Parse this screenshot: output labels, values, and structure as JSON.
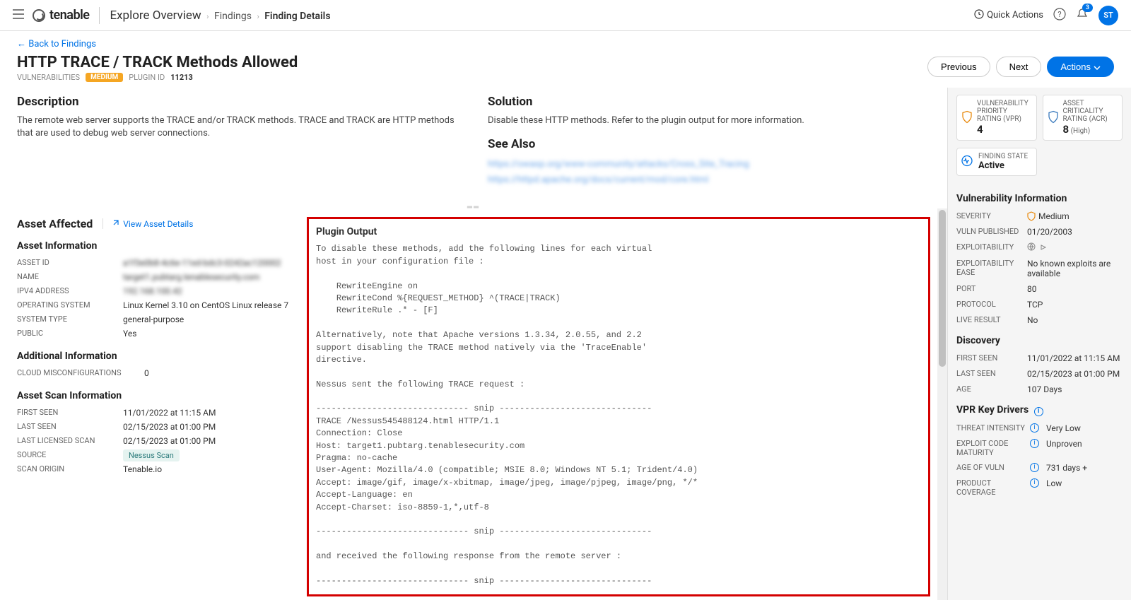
{
  "header": {
    "logo": "tenable",
    "breadcrumb_main": "Explore Overview",
    "breadcrumb_1": "Findings",
    "breadcrumb_2": "Finding Details",
    "quick_actions": "Quick Actions",
    "notif_count": "3",
    "avatar": "ST"
  },
  "page": {
    "back_link": "← Back to Findings",
    "title": "HTTP TRACE / TRACK Methods Allowed",
    "meta_label": "VULNERABILITIES",
    "severity": "MEDIUM",
    "plugin_label": "PLUGIN ID",
    "plugin_id": "11213",
    "btn_prev": "Previous",
    "btn_next": "Next",
    "btn_actions": "Actions"
  },
  "desc": {
    "heading": "Description",
    "text": "The remote web server supports the TRACE and/or TRACK methods. TRACE and TRACK are HTTP methods that are used to debug web server connections."
  },
  "solution": {
    "heading": "Solution",
    "text": "Disable these HTTP methods. Refer to the plugin output for more information.",
    "seealso_h": "See Also",
    "seealso_blur1": "https://owasp.org/www-community/attacks/Cross_Site_Tracing",
    "seealso_blur2": "https://httpd.apache.org/docs/current/mod/core.html"
  },
  "asset": {
    "section_h": "Asset Affected",
    "view_link": "View Asset Details",
    "info_h": "Asset Information",
    "id_k": "ASSET ID",
    "id_v": "a1f3e0b8-4c6e-11ed-bdc3-0242ac120002",
    "name_k": "NAME",
    "name_v": "target1.pubtarg.tenablesecurity.com",
    "ip_k": "IPV4 ADDRESS",
    "ip_v": "192.168.100.42",
    "os_k": "OPERATING SYSTEM",
    "os_v": "Linux Kernel 3.10 on CentOS Linux release 7",
    "type_k": "SYSTEM TYPE",
    "type_v": "general-purpose",
    "pub_k": "PUBLIC",
    "pub_v": "Yes",
    "addl_h": "Additional Information",
    "cloud_k": "CLOUD MISCONFIGURATIONS",
    "cloud_v": "0",
    "scan_h": "Asset Scan Information",
    "fs_k": "FIRST SEEN",
    "fs_v": "11/01/2022 at 11:15 AM",
    "ls_k": "LAST SEEN",
    "ls_v": "02/15/2023 at 01:00 PM",
    "lls_k": "LAST LICENSED SCAN",
    "lls_v": "02/15/2023 at 01:00 PM",
    "src_k": "SOURCE",
    "src_v": "Nessus Scan",
    "orig_k": "SCAN ORIGIN",
    "orig_v": "Tenable.io"
  },
  "plugin": {
    "heading": "Plugin Output",
    "output": "To disable these methods, add the following lines for each virtual\nhost in your configuration file :\n\n    RewriteEngine on\n    RewriteCond %{REQUEST_METHOD} ^(TRACE|TRACK)\n    RewriteRule .* - [F]\n\nAlternatively, note that Apache versions 1.3.34, 2.0.55, and 2.2\nsupport disabling the TRACE method natively via the 'TraceEnable'\ndirective.\n\nNessus sent the following TRACE request :\n\n------------------------------ snip ------------------------------\nTRACE /Nessus545488124.html HTTP/1.1\nConnection: Close\nHost: target1.pubtarg.tenablesecurity.com\nPragma: no-cache\nUser-Agent: Mozilla/4.0 (compatible; MSIE 8.0; Windows NT 5.1; Trident/4.0)\nAccept: image/gif, image/x-xbitmap, image/jpeg, image/pjpeg, image/png, */*\nAccept-Language: en\nAccept-Charset: iso-8859-1,*,utf-8\n\n------------------------------ snip ------------------------------\n\nand received the following response from the remote server :\n\n------------------------------ snip ------------------------------"
  },
  "side": {
    "vpr_label": "VULNERABILITY PRIORITY RATING (VPR)",
    "vpr_val": "4",
    "acr_label": "ASSET CRITICALITY RATING (ACR)",
    "acr_val": "8",
    "acr_sub": "(High)",
    "state_label": "FINDING STATE",
    "state_val": "Active",
    "vuln_h": "Vulnerability Information",
    "sev_k": "SEVERITY",
    "sev_v": "Medium",
    "pub_k": "VULN PUBLISHED",
    "pub_v": "01/20/2003",
    "exp_k": "EXPLOITABILITY",
    "ease_k": "EXPLOITABILITY EASE",
    "ease_v": "No known exploits are available",
    "port_k": "PORT",
    "port_v": "80",
    "proto_k": "PROTOCOL",
    "proto_v": "TCP",
    "live_k": "LIVE RESULT",
    "live_v": "No",
    "disc_h": "Discovery",
    "dfs_k": "FIRST SEEN",
    "dfs_v": "11/01/2022 at 11:15 AM",
    "dls_k": "LAST SEEN",
    "dls_v": "02/15/2023 at 01:00 PM",
    "age_k": "AGE",
    "age_v": "107 Days",
    "kd_h": "VPR Key Drivers",
    "ti_k": "THREAT INTENSITY",
    "ti_v": "Very Low",
    "ecm_k": "EXPLOIT CODE MATURITY",
    "ecm_v": "Unproven",
    "aov_k": "AGE OF VULN",
    "aov_v": "731 days +",
    "pc_k": "PRODUCT COVERAGE",
    "pc_v": "Low"
  }
}
